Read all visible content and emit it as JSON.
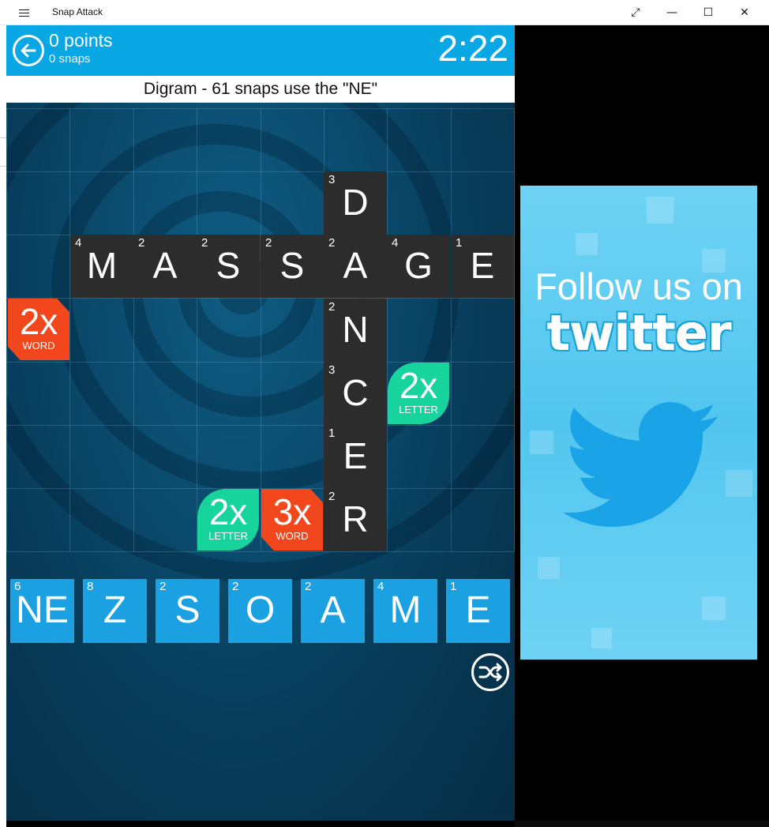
{
  "window": {
    "title": "Snap Attack",
    "restore_glyph": "⤢",
    "minimize_glyph": "—",
    "maximize_glyph": "☐",
    "close_glyph": "✕"
  },
  "header": {
    "points": "0 points",
    "snaps": "0 snaps",
    "timer": "2:22",
    "back_icon": "back-arrow-icon"
  },
  "hint": "Digram - 61 snaps use the \"NE\"",
  "board": {
    "tiles": [
      {
        "letter": "D",
        "points": "3"
      },
      {
        "letter": "M",
        "points": "4"
      },
      {
        "letter": "A",
        "points": "2"
      },
      {
        "letter": "S",
        "points": "2"
      },
      {
        "letter": "S",
        "points": "2"
      },
      {
        "letter": "A",
        "points": "2"
      },
      {
        "letter": "G",
        "points": "4"
      },
      {
        "letter": "E",
        "points": "1"
      },
      {
        "letter": "N",
        "points": "2"
      },
      {
        "letter": "C",
        "points": "3"
      },
      {
        "letter": "E",
        "points": "1"
      },
      {
        "letter": "R",
        "points": "2"
      }
    ],
    "bonuses": [
      {
        "mult": "2x",
        "kind": "WORD",
        "color": "#f2461c"
      },
      {
        "mult": "2x",
        "kind": "LETTER",
        "color": "#17d49d"
      },
      {
        "mult": "2x",
        "kind": "LETTER",
        "color": "#17d49d"
      },
      {
        "mult": "3x",
        "kind": "WORD",
        "color": "#f2461c"
      }
    ]
  },
  "rack": [
    {
      "letter": "NE",
      "points": "6"
    },
    {
      "letter": "Z",
      "points": "8"
    },
    {
      "letter": "S",
      "points": "2"
    },
    {
      "letter": "O",
      "points": "2"
    },
    {
      "letter": "A",
      "points": "2"
    },
    {
      "letter": "M",
      "points": "4"
    },
    {
      "letter": "E",
      "points": "1"
    }
  ],
  "shuffle_icon": "shuffle-icon",
  "ad": {
    "line1": "Follow us on",
    "brand": "twitter",
    "bird_icon": "twitter-bird-icon"
  },
  "colors": {
    "header": "#09a7e4",
    "tile": "#2c2c2c",
    "rack_tile": "#1ba1e2",
    "word_bonus": "#f2461c",
    "letter_bonus": "#17d49d"
  }
}
